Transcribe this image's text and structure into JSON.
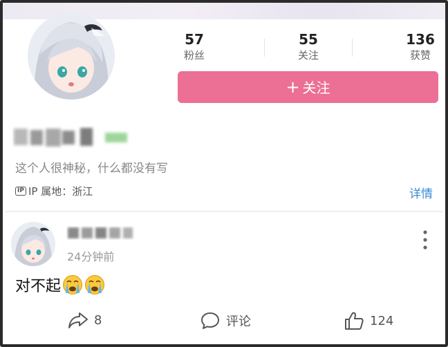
{
  "profile": {
    "stats": [
      {
        "value": "57",
        "label": "粉丝"
      },
      {
        "value": "55",
        "label": "关注"
      },
      {
        "value": "136",
        "label": "获赞"
      }
    ],
    "follow_button": {
      "plus": "+",
      "label": "关注"
    },
    "bio": "这个人很神秘，什么都没有写",
    "ip_icon_text": "IP",
    "ip_location": "IP 属地：浙江",
    "detail_link": "详情"
  },
  "post": {
    "time": "24分钟前",
    "text": "对不起",
    "emojis": [
      "crying-face-icon",
      "crying-face-icon"
    ],
    "actions": [
      {
        "icon": "share-icon",
        "count": "8"
      },
      {
        "icon": "comment-icon",
        "label": "评论"
      },
      {
        "icon": "like-icon",
        "count": "124"
      }
    ]
  },
  "colors": {
    "accent_pink": "#ec6f96",
    "link_blue": "#3a8bd6"
  }
}
